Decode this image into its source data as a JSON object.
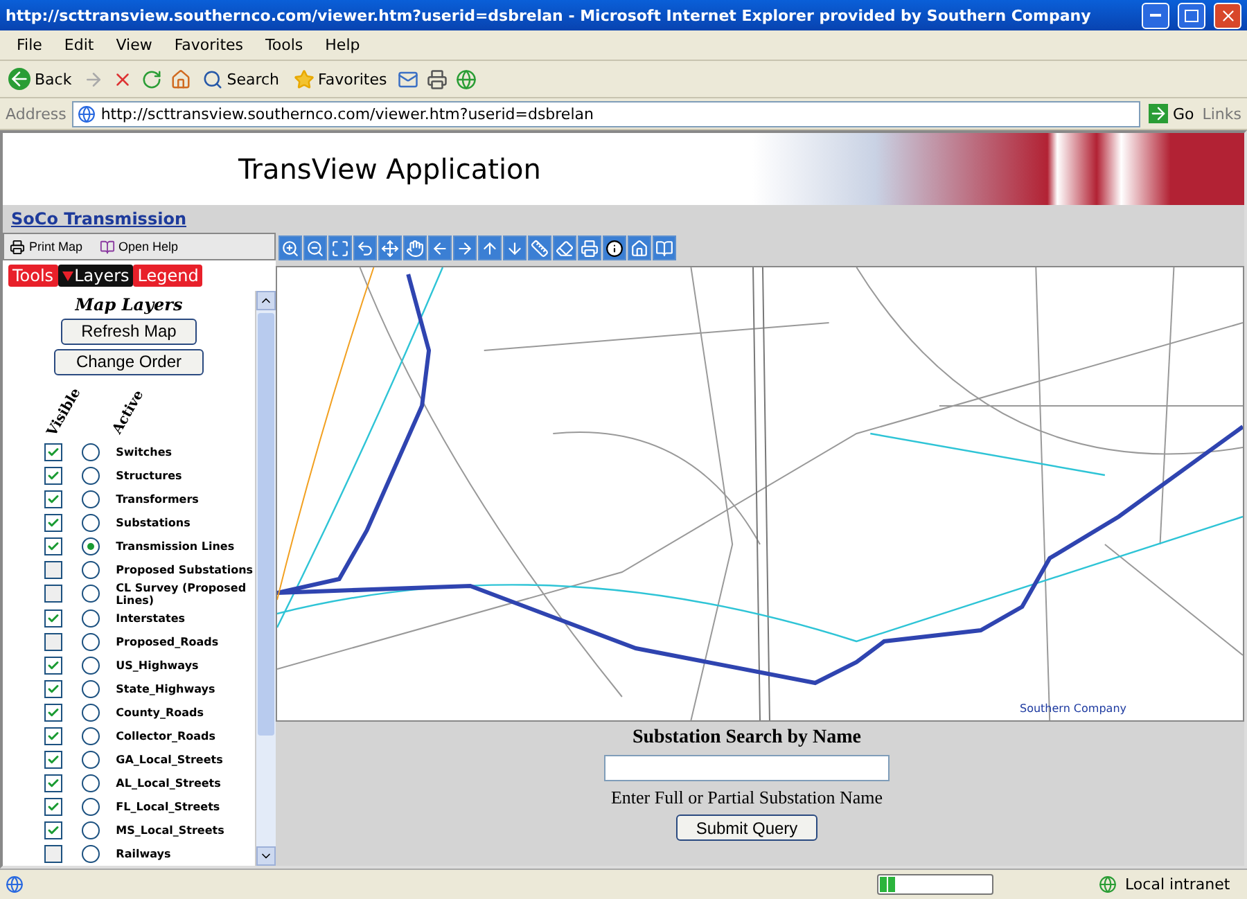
{
  "window": {
    "title": "http://scttransview.southernco.com/viewer.htm?userid=dsbrelan - Microsoft Internet Explorer provided by Southern Company"
  },
  "menu": [
    "File",
    "Edit",
    "View",
    "Favorites",
    "Tools",
    "Help"
  ],
  "toolbar": [
    {
      "kind": "back",
      "label": "Back"
    },
    {
      "kind": "search",
      "label": "Search"
    },
    {
      "kind": "favorites",
      "label": "Favorites"
    }
  ],
  "address": {
    "label": "Address",
    "url": "http://scttransview.southernco.com/viewer.htm?userid=dsbrelan",
    "go": "Go",
    "links": "Links"
  },
  "page": {
    "title": "TransView Application",
    "link": "SoCo Transmission",
    "actions": [
      "Print Map",
      "Open Help"
    ],
    "tabs": [
      {
        "label": "Tools",
        "selected": false
      },
      {
        "label": "Layers",
        "selected": true
      },
      {
        "label": "Legend",
        "selected": false
      }
    ],
    "panel_title": "Map Layers",
    "buttons": [
      "Refresh Map",
      "Change Order"
    ],
    "columns": [
      "Visible",
      "Active"
    ],
    "layers": [
      {
        "name": "Switches",
        "visible": true,
        "active": false
      },
      {
        "name": "Structures",
        "visible": true,
        "active": false
      },
      {
        "name": "Transformers",
        "visible": true,
        "active": false
      },
      {
        "name": "Substations",
        "visible": true,
        "active": false
      },
      {
        "name": "Transmission Lines",
        "visible": true,
        "active": true
      },
      {
        "name": "Proposed Substations",
        "visible": false,
        "active": false
      },
      {
        "name": "CL Survey (Proposed Lines)",
        "visible": false,
        "active": false
      },
      {
        "name": "Interstates",
        "visible": true,
        "active": false
      },
      {
        "name": "Proposed_Roads",
        "visible": false,
        "active": false
      },
      {
        "name": "US_Highways",
        "visible": true,
        "active": false
      },
      {
        "name": "State_Highways",
        "visible": true,
        "active": false
      },
      {
        "name": "County_Roads",
        "visible": true,
        "active": false
      },
      {
        "name": "Collector_Roads",
        "visible": true,
        "active": false
      },
      {
        "name": "GA_Local_Streets",
        "visible": true,
        "active": false
      },
      {
        "name": "AL_Local_Streets",
        "visible": true,
        "active": false
      },
      {
        "name": "FL_Local_Streets",
        "visible": true,
        "active": false
      },
      {
        "name": "MS_Local_Streets",
        "visible": true,
        "active": false
      },
      {
        "name": "Railways",
        "visible": false,
        "active": false
      }
    ],
    "map_credit": "Southern Company",
    "search": {
      "title": "Substation Search by Name",
      "hint": "Enter Full or Partial Substation Name",
      "button": "Submit Query"
    }
  },
  "status_bar": {
    "progress": {
      "level": 0.15
    },
    "zone": "Local intranet"
  }
}
